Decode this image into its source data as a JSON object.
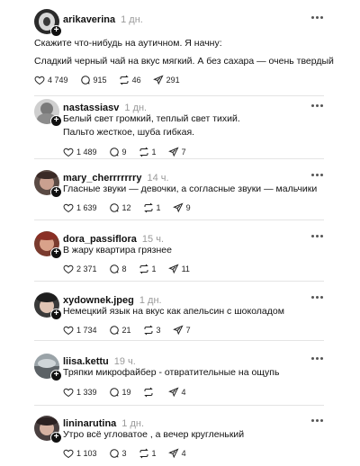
{
  "icons": {
    "like": "heart-icon",
    "comment": "comment-icon",
    "repost": "repost-icon",
    "share": "share-icon",
    "more": "more-icon",
    "follow": "plus-icon"
  },
  "colors": {
    "text": "#111111",
    "muted": "#9a9a9a",
    "divider": "#e4e4e4"
  },
  "posts": [
    {
      "username": "arikaverina",
      "time": "1 дн.",
      "lines": [
        "Скажите что-нибудь на аутичном. Я начну:",
        "Сладкий черный чай на вкус мягкий. А без сахара — очень твердый"
      ],
      "likes": "4 749",
      "comments": "915",
      "reposts": "46",
      "shares": "291"
    },
    {
      "username": "nastassiasv",
      "time": "1 дн.",
      "lines": [
        "Белый свет громкий, теплый свет тихий.",
        "Пальто жесткое, шуба гибкая."
      ],
      "likes": "1 489",
      "comments": "9",
      "reposts": "1",
      "shares": "7"
    },
    {
      "username": "mary_cherrrrrrry",
      "time": "14 ч.",
      "lines": [
        "Гласные звуки — девочки, а согласные звуки — мальчики"
      ],
      "likes": "1 639",
      "comments": "12",
      "reposts": "1",
      "shares": "9"
    },
    {
      "username": "dora_passiflora",
      "time": "15 ч.",
      "lines": [
        "В жару квартира грязнее"
      ],
      "likes": "2 371",
      "comments": "8",
      "reposts": "1",
      "shares": "11"
    },
    {
      "username": "xydownek.jpeg",
      "time": "1 дн.",
      "lines": [
        "Немецкий язык на вкус как апельсин с шоколадом"
      ],
      "likes": "1 734",
      "comments": "21",
      "reposts": "3",
      "shares": "7"
    },
    {
      "username": "liisa.kettu",
      "time": "19 ч.",
      "lines": [
        "Тряпки микрофайбер - отвратительные на ощупь"
      ],
      "likes": "1 339",
      "comments": "19",
      "reposts": "",
      "shares": "4"
    },
    {
      "username": "lininarutina",
      "time": "1 дн.",
      "lines": [
        "Утро всё угловатое , а вечер кругленький"
      ],
      "likes": "1 103",
      "comments": "3",
      "reposts": "1",
      "shares": "4"
    }
  ]
}
